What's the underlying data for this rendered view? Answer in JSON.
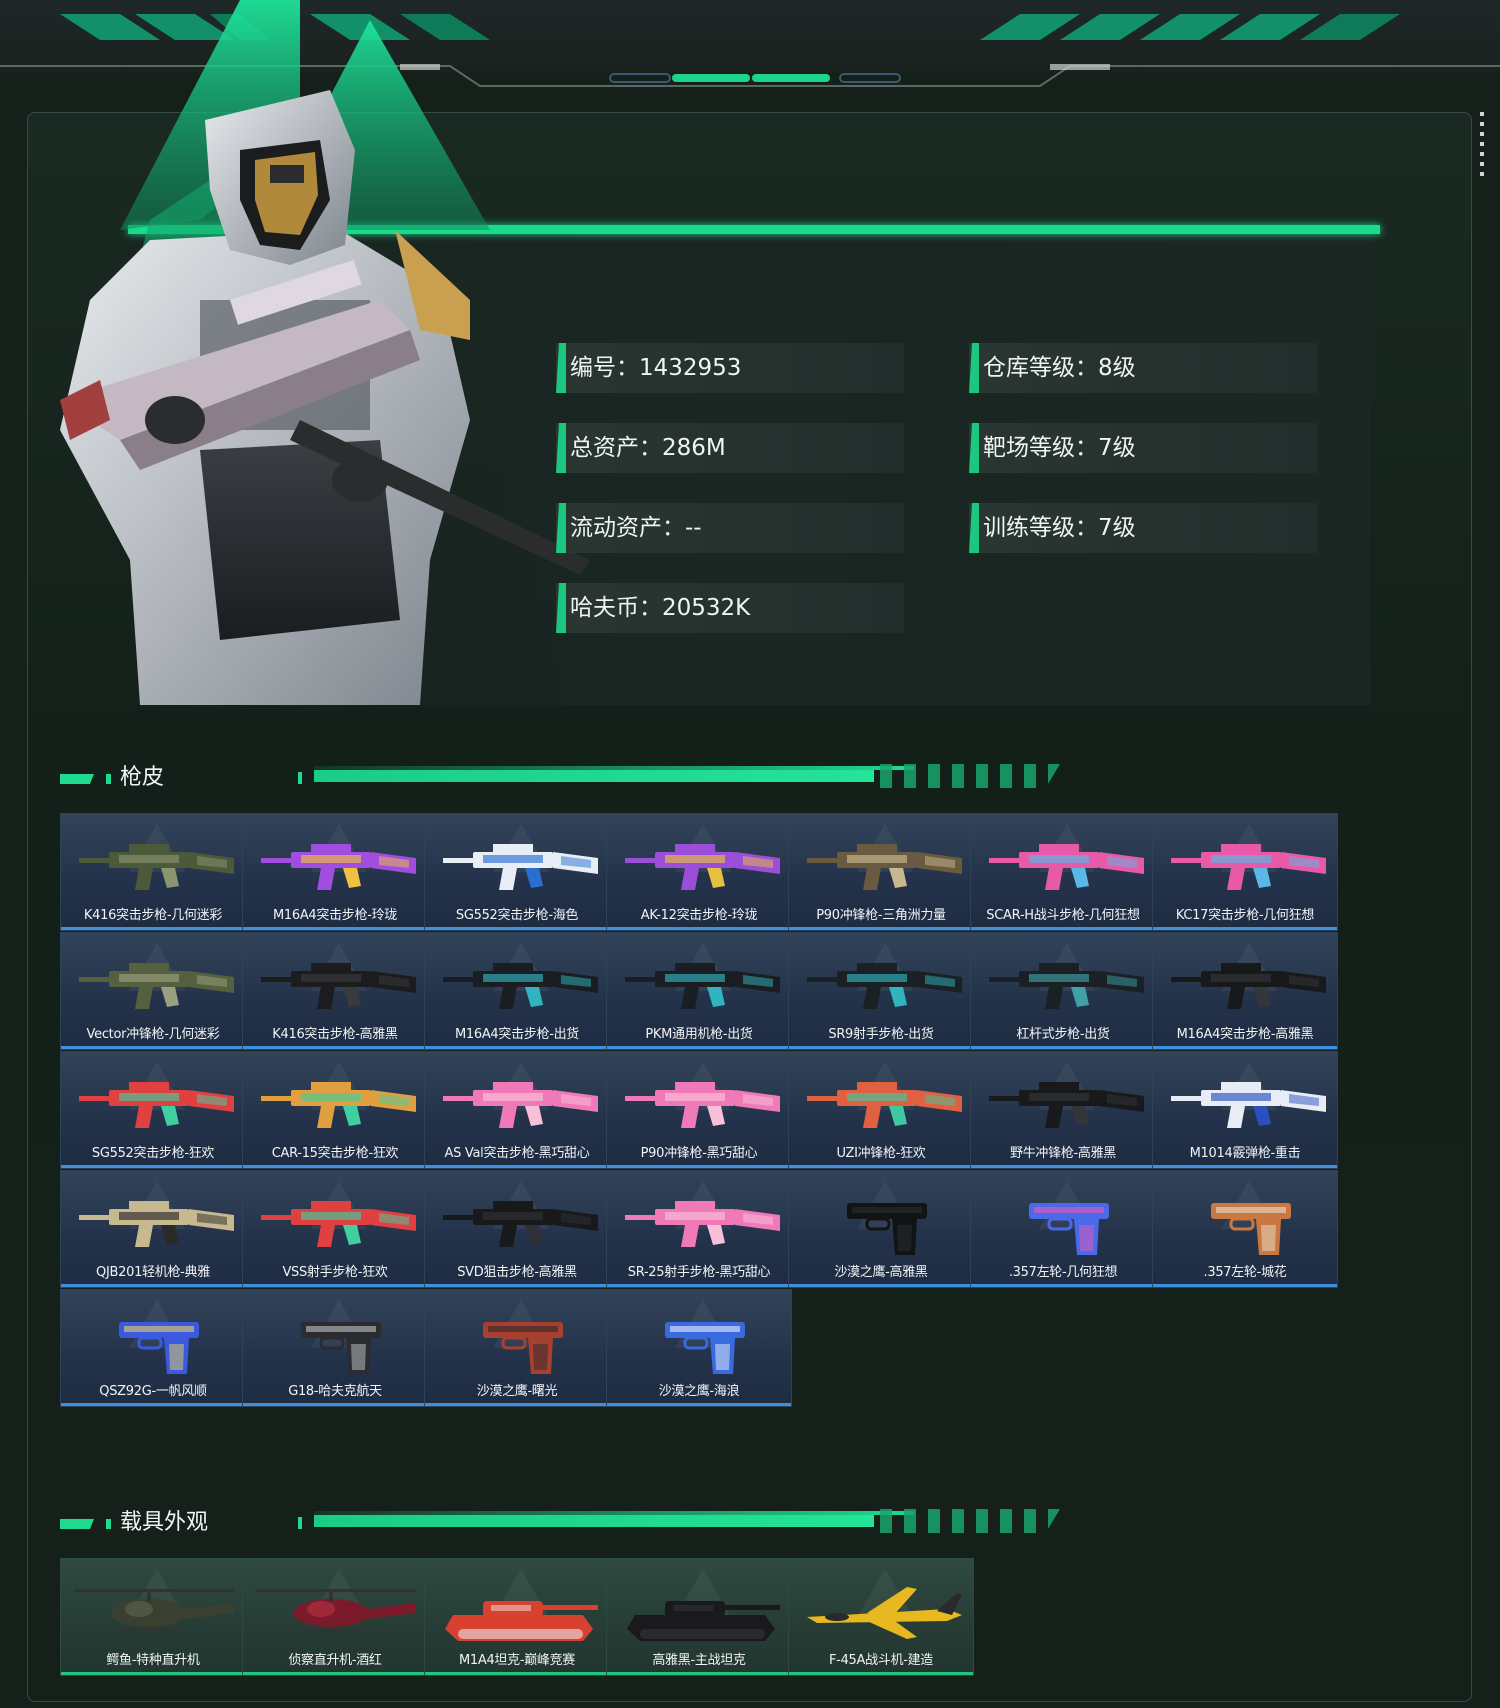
{
  "colors": {
    "accent": "#1edb8f",
    "weapon_card": "#2a3b52",
    "weapon_underline": "#3f8fe0",
    "vehicle_card": "#2a4339",
    "vehicle_underline": "#22c480"
  },
  "profile": {
    "stats": [
      {
        "label": "编号：1432953"
      },
      {
        "label": "仓库等级：8级"
      },
      {
        "label": "总资产：286M"
      },
      {
        "label": "靶场等级：7级"
      },
      {
        "label": "流动资产：--"
      },
      {
        "label": "训练等级：7级"
      },
      {
        "label": "哈夫币：20532K"
      }
    ]
  },
  "skins_section": {
    "title": "枪皮"
  },
  "weapons": [
    {
      "name": "K416突击步枪-几何迷彩",
      "c1": "#4d5a3a",
      "c2": "#8a9470"
    },
    {
      "name": "M16A4突击步枪-玲珑",
      "c1": "#a04de0",
      "c2": "#f0c040"
    },
    {
      "name": "SG552突击步枪-海色",
      "c1": "#e8eef5",
      "c2": "#2a6fd0"
    },
    {
      "name": "AK-12突击步枪-玲珑",
      "c1": "#9b4fd8",
      "c2": "#e8c040"
    },
    {
      "name": "P90冲锋枪-三角洲力量",
      "c1": "#6a5a40",
      "c2": "#c8b890"
    },
    {
      "name": "SCAR-H战斗步枪-几何狂想",
      "c1": "#e85aa8",
      "c2": "#5ab8e8"
    },
    {
      "name": "KC17突击步枪-几何狂想",
      "c1": "#e85aa8",
      "c2": "#5ab8e8"
    },
    {
      "name": "Vector冲锋枪-几何迷彩",
      "c1": "#55603e",
      "c2": "#9aa080"
    },
    {
      "name": "K416突击步枪-高雅黑",
      "c1": "#1c1c1e",
      "c2": "#3a3a3e"
    },
    {
      "name": "M16A4突击步枪-出货",
      "c1": "#1a1e22",
      "c2": "#2fb4c0"
    },
    {
      "name": "PKM通用机枪-出货",
      "c1": "#1a1e22",
      "c2": "#2fb4c0"
    },
    {
      "name": "SR9射手步枪-出货",
      "c1": "#1a2024",
      "c2": "#2fb4c0"
    },
    {
      "name": "杠杆式步枪-出货",
      "c1": "#1a2024",
      "c2": "#3fa0a8"
    },
    {
      "name": "M16A4突击步枪-高雅黑",
      "c1": "#18191b",
      "c2": "#35363a"
    },
    {
      "name": "SG552突击步枪-狂欢",
      "c1": "#e04040",
      "c2": "#40d0a0"
    },
    {
      "name": "CAR-15突击步枪-狂欢",
      "c1": "#e0a040",
      "c2": "#40d0a0"
    },
    {
      "name": "AS Val突击步枪-黑巧甜心",
      "c1": "#f07ab8",
      "c2": "#f8c0d8"
    },
    {
      "name": "P90冲锋枪-黑巧甜心",
      "c1": "#f07ab8",
      "c2": "#f8c0d8"
    },
    {
      "name": "UZI冲锋枪-狂欢",
      "c1": "#e06040",
      "c2": "#40c8a0"
    },
    {
      "name": "野牛冲锋枪-高雅黑",
      "c1": "#18191b",
      "c2": "#34353a"
    },
    {
      "name": "M1014霰弹枪-重击",
      "c1": "#e8ecf4",
      "c2": "#2a50c0"
    },
    {
      "name": "QJB201轻机枪-典雅",
      "c1": "#c8b890",
      "c2": "#2a2a2a"
    },
    {
      "name": "VSS射手步枪-狂欢",
      "c1": "#e04040",
      "c2": "#40d0a0"
    },
    {
      "name": "SVD狙击步枪-高雅黑",
      "c1": "#18191b",
      "c2": "#303136"
    },
    {
      "name": "SR-25射手步枪-黑巧甜心",
      "c1": "#f07ab8",
      "c2": "#f8c0d8"
    },
    {
      "name": "沙漠之鹰-高雅黑",
      "c1": "#121314",
      "c2": "#2c2d30"
    },
    {
      "name": ".357左轮-几何狂想",
      "c1": "#4a6ae8",
      "c2": "#e85ab8"
    },
    {
      "name": ".357左轮-城花",
      "c1": "#c87840",
      "c2": "#e8e0d0"
    },
    {
      "name": "QSZ92G-一帆风顺",
      "c1": "#3a5ae0",
      "c2": "#e8d060"
    },
    {
      "name": "G18-哈夫克航天",
      "c1": "#2a2c30",
      "c2": "#c0c4c8"
    },
    {
      "name": "沙漠之鹰-曙光",
      "c1": "#a84030",
      "c2": "#2a2a2e"
    },
    {
      "name": "沙漠之鹰-海浪",
      "c1": "#3a6ae0",
      "c2": "#e8f0f8"
    }
  ],
  "vehicles_section": {
    "title": "载具外观"
  },
  "vehicles": [
    {
      "name": "鳄鱼-特种直升机",
      "c1": "#3a4030",
      "c2": "#5a6048"
    },
    {
      "name": "侦察直升机-酒红",
      "c1": "#7a1a2a",
      "c2": "#b03040"
    },
    {
      "name": "M1A4坦克-巅峰竞赛",
      "c1": "#d84030",
      "c2": "#e8e8e8"
    },
    {
      "name": "高雅黑-主战坦克",
      "c1": "#1a1a1c",
      "c2": "#34363a"
    },
    {
      "name": "F-45A战斗机-建造",
      "c1": "#e8b820",
      "c2": "#2a2a2a"
    }
  ]
}
